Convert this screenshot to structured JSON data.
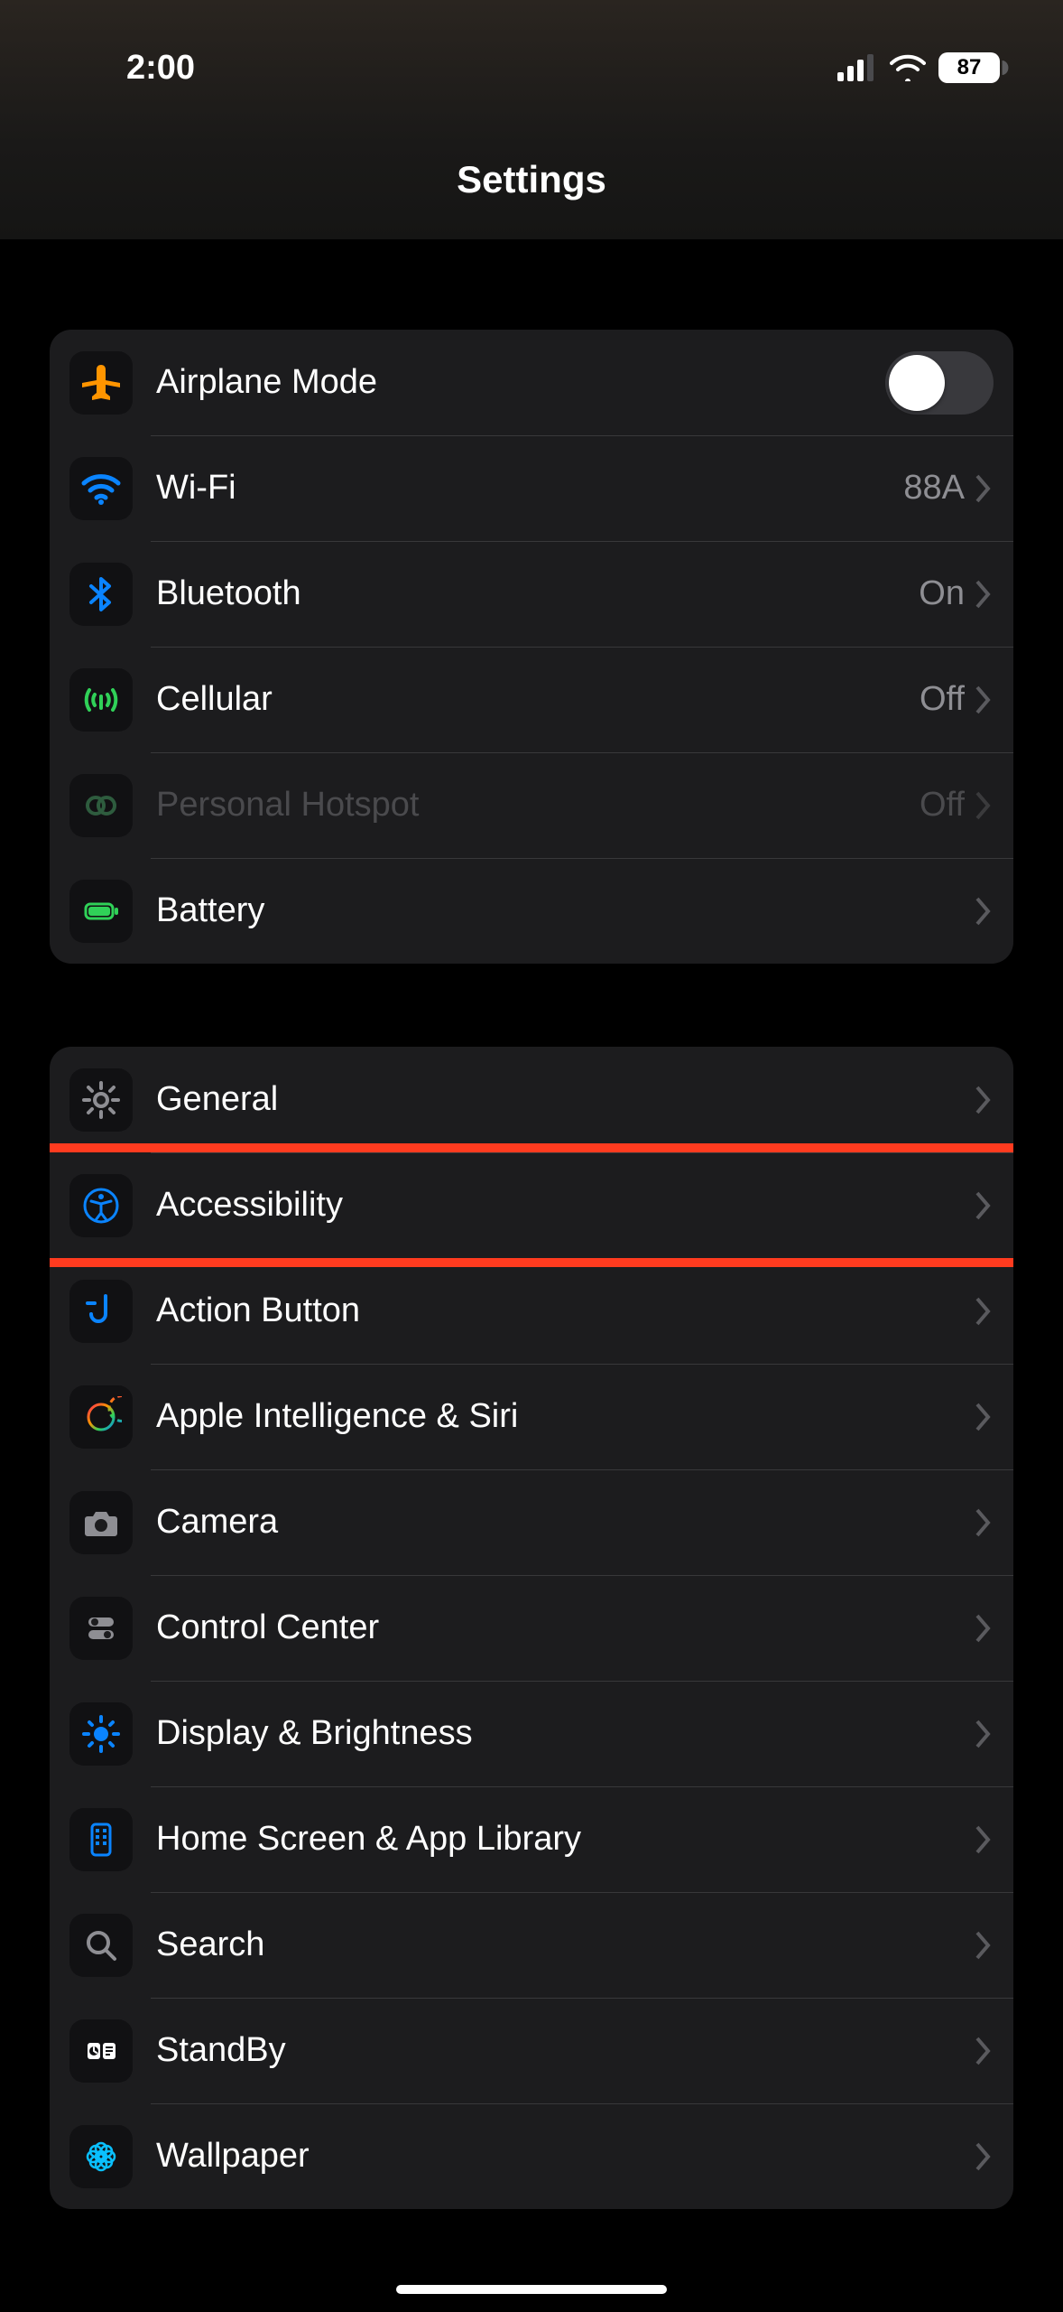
{
  "status": {
    "time": "2:00",
    "battery_percent": "87"
  },
  "header": {
    "title": "Settings"
  },
  "group1": {
    "airplane": {
      "label": "Airplane Mode",
      "toggle": false
    },
    "wifi": {
      "label": "Wi-Fi",
      "value": "88A"
    },
    "bluetooth": {
      "label": "Bluetooth",
      "value": "On"
    },
    "cellular": {
      "label": "Cellular",
      "value": "Off"
    },
    "hotspot": {
      "label": "Personal Hotspot",
      "value": "Off",
      "disabled": true
    },
    "battery": {
      "label": "Battery"
    }
  },
  "group2": {
    "general": {
      "label": "General"
    },
    "accessibility": {
      "label": "Accessibility",
      "highlighted": true
    },
    "action_button": {
      "label": "Action Button"
    },
    "ai_siri": {
      "label": "Apple Intelligence & Siri"
    },
    "camera": {
      "label": "Camera"
    },
    "control_center": {
      "label": "Control Center"
    },
    "display": {
      "label": "Display & Brightness"
    },
    "home_screen": {
      "label": "Home Screen & App Library"
    },
    "search": {
      "label": "Search"
    },
    "standby": {
      "label": "StandBy"
    },
    "wallpaper": {
      "label": "Wallpaper"
    }
  },
  "icons": {
    "airplane_color": "#ff9500",
    "wifi_color": "#0a84ff",
    "bluetooth_color": "#0a84ff",
    "cellular_color": "#30d158",
    "hotspot_color": "#2a6b3d",
    "battery_color": "#30d158",
    "general_color": "#8e8e93",
    "accessibility_color": "#0a84ff",
    "action_button_color": "#0a84ff",
    "camera_color": "#8e8e93",
    "control_center_color": "#8e8e93",
    "display_color": "#0a84ff",
    "home_screen_color": "#0a84ff",
    "search_color": "#8e8e93",
    "standby_bg": "#000000",
    "tile_bg": "#111113"
  }
}
